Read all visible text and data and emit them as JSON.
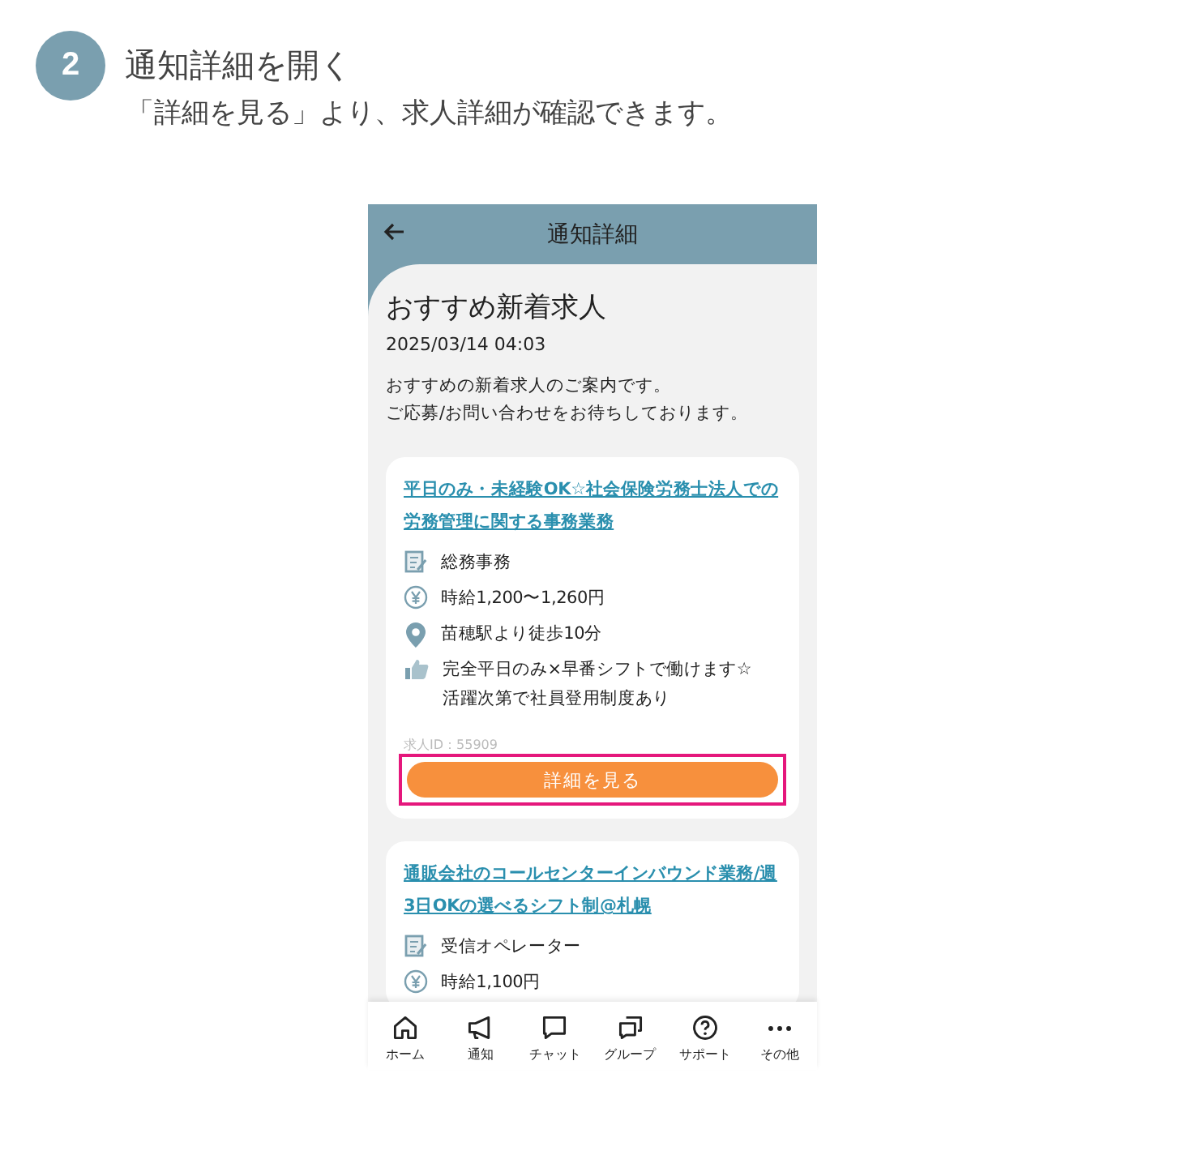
{
  "step": {
    "number": "2",
    "title": "通知詳細を開く",
    "description": "「詳細を見る」より、求人詳細が確認できます。"
  },
  "phone": {
    "header": {
      "title": "通知詳細"
    },
    "notice": {
      "title": "おすすめ新着求人",
      "date": "2025/03/14 04:03",
      "body": [
        "おすすめの新着求人のご案内です。",
        "ご応募/お問い合わせをお待ちしております。"
      ]
    },
    "jobs": [
      {
        "title": "平日のみ・未経験OK☆社会保険労務士法人での労務管理に関する事務業務",
        "items": [
          {
            "kind": "category",
            "text": "総務事務"
          },
          {
            "kind": "wage",
            "text": "時給1,200〜1,260円"
          },
          {
            "kind": "access",
            "text": "苗穂駅より徒歩10分"
          },
          {
            "kind": "feature",
            "text": "完全平日のみ×早番シフトで働けます☆\n活躍次第で社員登用制度あり"
          }
        ],
        "job_id": "求人ID：55909",
        "button": {
          "label": "詳細を見る",
          "highlighted": true
        }
      },
      {
        "title": "通販会社のコールセンターインバウンド業務/週3日OKの選べるシフト制@札幌",
        "items": [
          {
            "kind": "category",
            "text": "受信オペレーター"
          },
          {
            "kind": "wage",
            "text": "時給1,100円"
          }
        ]
      }
    ],
    "nav": [
      {
        "label": "ホーム"
      },
      {
        "label": "通知"
      },
      {
        "label": "チャット"
      },
      {
        "label": "グループ"
      },
      {
        "label": "サポート"
      },
      {
        "label": "その他"
      }
    ]
  }
}
